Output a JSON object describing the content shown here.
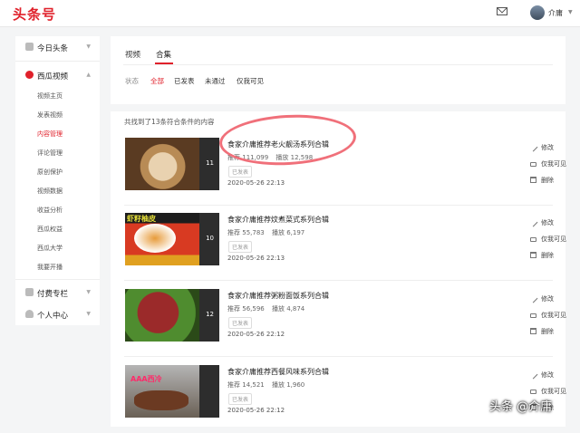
{
  "header": {
    "logo": "头条号",
    "username": "介庸",
    "icons": [
      "mail-icon",
      "avatar",
      "chevron-down-icon"
    ]
  },
  "sidebar": {
    "groups": [
      {
        "label": "今日头条",
        "icon": "grid-icon"
      },
      {
        "label": "西瓜视频",
        "icon": "xigua-icon",
        "items": [
          "视频主页",
          "发表视频",
          "内容管理",
          "评论管理",
          "原创保护",
          "视频数据",
          "收益分析",
          "西瓜权益",
          "西瓜大学",
          "我要开播"
        ],
        "active_item": "内容管理"
      },
      {
        "label": "付费专栏",
        "icon": "column-icon"
      },
      {
        "label": "个人中心",
        "icon": "user-icon"
      }
    ]
  },
  "tabs": [
    {
      "label": "视频",
      "active": false
    },
    {
      "label": "合集",
      "active": true
    }
  ],
  "filters": {
    "label": "状态",
    "options": [
      "全部",
      "已发表",
      "未通过",
      "仅我可见"
    ],
    "active": "全部"
  },
  "result_text": "共找到了13条符合条件的内容",
  "stat_labels": {
    "recommend": "推荐",
    "plays": "播放"
  },
  "actions": {
    "edit": "修改",
    "private": "仅我可见",
    "delete": "删除"
  },
  "collections": [
    {
      "title": "食家介庸推荐老火靓汤系列合辑",
      "recommend": "111,099",
      "plays": "12,598",
      "status": "已发表",
      "date": "2020-05-26 22:13",
      "count": "11"
    },
    {
      "title": "食家介庸推荐炆煮菜式系列合辑",
      "recommend": "55,783",
      "plays": "6,197",
      "status": "已发表",
      "date": "2020-05-26 22:13",
      "count": "10",
      "thumb_text": "虾籽柚皮"
    },
    {
      "title": "食家介庸推荐粥粉面饭系列合辑",
      "recommend": "56,596",
      "plays": "4,874",
      "status": "已发表",
      "date": "2020-05-26 22:12",
      "count": "12"
    },
    {
      "title": "食家介庸推荐西餐风味系列合辑",
      "recommend": "14,521",
      "plays": "1,960",
      "status": "已发表",
      "date": "2020-05-26 22:12",
      "count": "",
      "thumb_text": "AAA西冷"
    }
  ],
  "watermark": "头条 @介庸",
  "colors": {
    "accent": "#e0212b",
    "annotation": "#f0707a"
  }
}
